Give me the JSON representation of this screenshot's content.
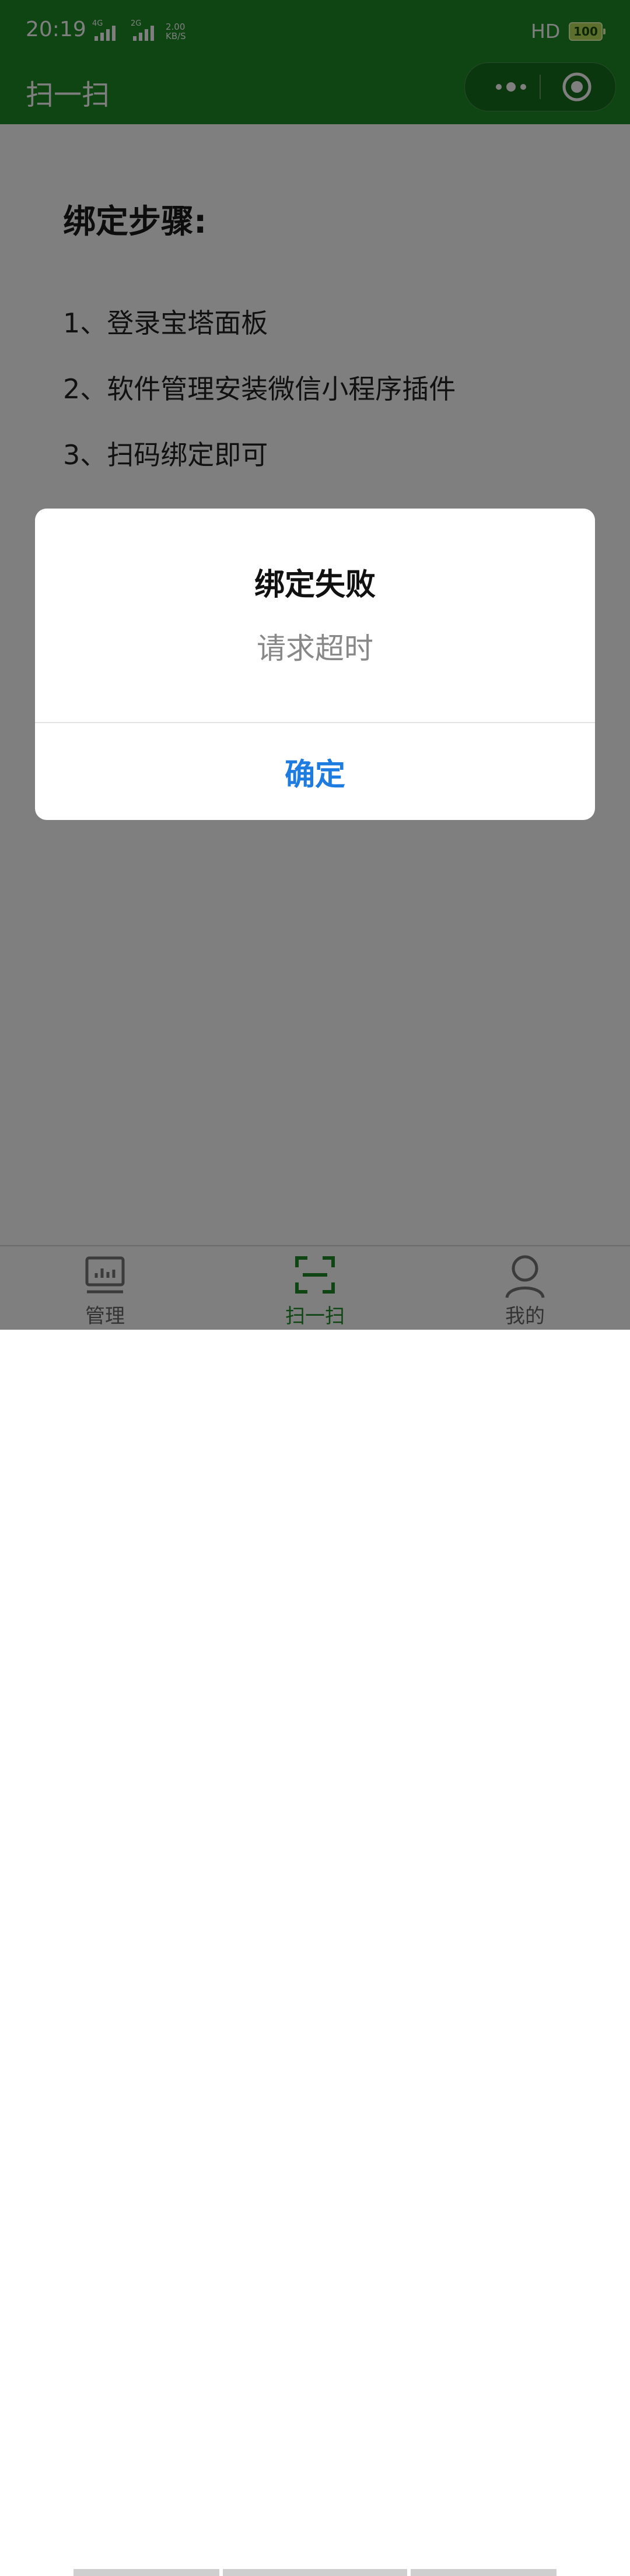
{
  "status": {
    "time": "20:19",
    "signal1": "4G",
    "signal2": "2G",
    "speed_value": "2.00",
    "speed_unit": "KB/S",
    "hd": "HD",
    "battery": "100"
  },
  "nav": {
    "title": "扫一扫"
  },
  "content": {
    "steps_title": "绑定步骤:",
    "steps": [
      "1、登录宝塔面板",
      "2、软件管理安装微信小程序插件",
      "3、扫码绑定即可"
    ]
  },
  "tabbar": {
    "items": [
      {
        "label": "管理",
        "icon": "chart-board-icon"
      },
      {
        "label": "扫一扫",
        "icon": "scan-icon"
      },
      {
        "label": "我的",
        "icon": "user-icon"
      }
    ],
    "active_index": 1
  },
  "modal": {
    "title": "绑定失败",
    "message": "请求超时",
    "confirm_label": "确定"
  },
  "colors": {
    "brand_green": "#1c8a24",
    "link_blue": "#1e7be0"
  }
}
